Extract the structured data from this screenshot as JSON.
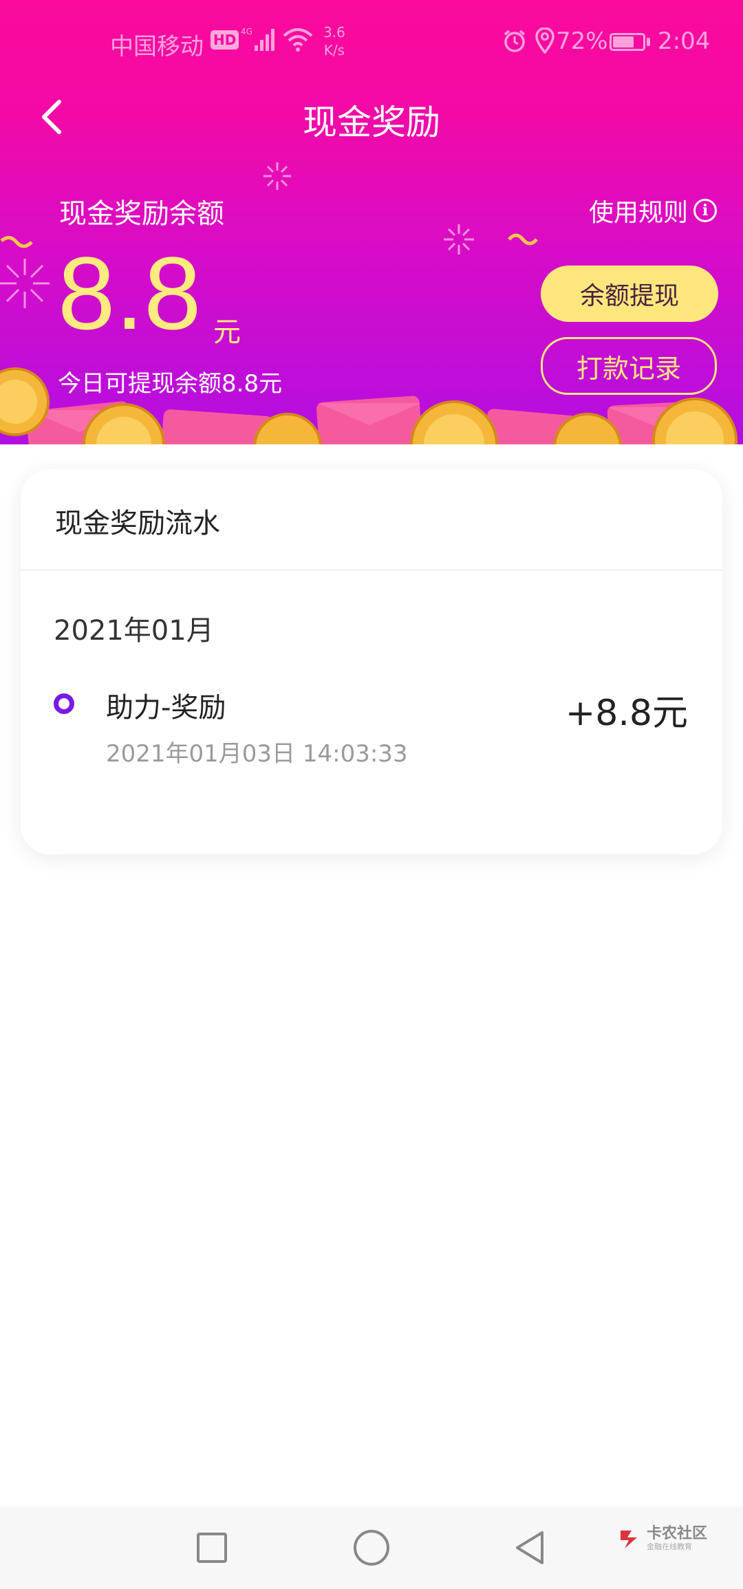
{
  "status": {
    "carrier": "中国移动",
    "hd": "HD",
    "network": "4G",
    "speed_value": "3.6",
    "speed_unit": "K/s",
    "battery": "72%",
    "battery_level": 0.72,
    "time": "2:04"
  },
  "header": {
    "title": "现金奖励"
  },
  "balance": {
    "label": "现金奖励余额",
    "rules": "使用规则",
    "amount": "8.8",
    "unit": "元",
    "today_withdrawable": "今日可提现余额8.8元",
    "withdraw_button": "余额提现",
    "records_button": "打款记录"
  },
  "flow": {
    "title": "现金奖励流水",
    "month": "2021年01月",
    "items": [
      {
        "title": "助力-奖励",
        "time": "2021年01月03日 14:03:33",
        "amount": "+8.8元"
      }
    ]
  },
  "watermark": {
    "name": "卡农社区",
    "tagline": "金融在线教育"
  },
  "colors": {
    "accent_purple": "#7a1ae6",
    "gold": "#fde77d",
    "pink": "#fb0a9c",
    "violet": "#b20fe2"
  }
}
